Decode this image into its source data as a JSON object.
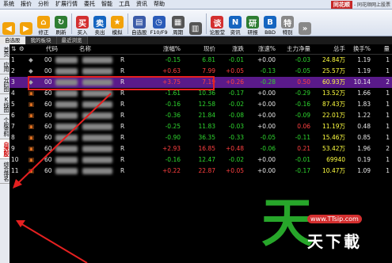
{
  "menubar": {
    "items": [
      "系统",
      "报价",
      "分析",
      "扩展行情",
      "委托",
      "智能",
      "工具",
      "资讯",
      "帮助"
    ],
    "logo": "同花顺",
    "title": "- 同花顺网上股票"
  },
  "toolbar": {
    "buttons": [
      {
        "label": "",
        "icon": "arrow-left-icon",
        "color": "#f2a20a"
      },
      {
        "label": "",
        "icon": "arrow-right-icon",
        "color": "#f2a20a"
      },
      {
        "label": "修正",
        "icon": "home-icon",
        "color": "#f2a20a"
      },
      {
        "label": "刷新",
        "icon": "refresh-icon",
        "color": "#2e7d32"
      },
      {
        "label": "买入",
        "icon": "buy-icon",
        "color": "#d32f2f"
      },
      {
        "label": "卖出",
        "icon": "sell-icon",
        "color": "#1565c0"
      },
      {
        "label": "模拟",
        "icon": "simulate-icon",
        "color": "#f2a20a"
      },
      {
        "label": "自选股",
        "icon": "watchlist-icon",
        "color": "#3b5ba8"
      },
      {
        "label": "F10/F9",
        "icon": "clock-icon",
        "color": "#2a5bb8"
      },
      {
        "label": "周期",
        "icon": "cycle-icon",
        "color": "#555"
      },
      {
        "label": "",
        "icon": "bars-icon",
        "color": "#555"
      },
      {
        "label": "论股堂",
        "icon": "discussion-icon",
        "color": "#d32f2f"
      },
      {
        "label": "资讯",
        "icon": "news-icon",
        "color": "#1565c0"
      },
      {
        "label": "研报",
        "icon": "report-icon",
        "color": "#2e7d32"
      },
      {
        "label": "BBD",
        "icon": "bbd-icon",
        "color": "#1565c0"
      },
      {
        "label": "特别",
        "icon": "special-icon",
        "color": "#888"
      },
      {
        "label": "",
        "icon": "more-icon",
        "color": "#888"
      }
    ]
  },
  "tabs": [
    {
      "label": "自选股",
      "active": true
    },
    {
      "label": "我的板块",
      "active": false
    },
    {
      "label": "最近浏览",
      "active": false
    }
  ],
  "sidepanel": [
    {
      "label": "首页",
      "active": false
    },
    {
      "label": "应用",
      "active": false
    },
    {
      "label": "分时图",
      "active": false
    },
    {
      "label": "K线图",
      "active": false
    },
    {
      "label": "个股资料",
      "active": false
    },
    {
      "label": "自选股",
      "active": true
    },
    {
      "label": "综合排名",
      "active": false
    }
  ],
  "table": {
    "headers": [
      "代码",
      "名称",
      "",
      "涨幅%",
      "现价",
      "涨跌",
      "涨速%",
      "主力净量",
      "总手",
      "换手%",
      "量"
    ],
    "rows": [
      {
        "n": "1",
        "code": "00",
        "name": "",
        "flag": "R",
        "pct": "-0.15",
        "price": "6.81",
        "chg": "-0.01",
        "speed": "+0.00",
        "net": "-0.03",
        "vol": "24.84万",
        "turn": "1.19",
        "qty": "1",
        "dir": "dn"
      },
      {
        "n": "2",
        "code": "00",
        "name": "",
        "flag": "R",
        "pct": "+0.63",
        "price": "7.99",
        "chg": "+0.05",
        "speed": "-0.13",
        "net": "-0.05",
        "vol": "25.57万",
        "turn": "1.19",
        "qty": "1",
        "dir": "up"
      },
      {
        "n": "3",
        "code": "00",
        "name": "",
        "flag": "R",
        "pct": "+3.75",
        "price": "7.19",
        "chg": "+0.26",
        "speed": "-0.28",
        "net": "0.50",
        "vol": "60.93万",
        "turn": "10.14",
        "qty": "2",
        "dir": "up",
        "selected": true
      },
      {
        "n": "4",
        "code": "60",
        "name": "",
        "flag": "R",
        "pct": "-1.61",
        "price": "10.36",
        "chg": "-0.17",
        "speed": "+0.00",
        "net": "-0.29",
        "vol": "13.52万",
        "turn": "1.66",
        "qty": "1",
        "dir": "dn"
      },
      {
        "n": "5",
        "code": "60",
        "name": "",
        "flag": "R",
        "pct": "-0.16",
        "price": "12.58",
        "chg": "-0.02",
        "speed": "+0.00",
        "net": "-0.16",
        "vol": "87.43万",
        "turn": "1.83",
        "qty": "1",
        "dir": "dn"
      },
      {
        "n": "6",
        "code": "60",
        "name": "",
        "flag": "R",
        "pct": "-0.36",
        "price": "21.84",
        "chg": "-0.08",
        "speed": "+0.00",
        "net": "-0.09",
        "vol": "22.01万",
        "turn": "1.22",
        "qty": "1",
        "dir": "dn"
      },
      {
        "n": "7",
        "code": "60",
        "name": "",
        "flag": "R",
        "pct": "-0.25",
        "price": "11.83",
        "chg": "-0.03",
        "speed": "+0.00",
        "net": "0.06",
        "vol": "11.19万",
        "turn": "0.48",
        "qty": "1",
        "dir": "dn"
      },
      {
        "n": "8",
        "code": "60",
        "name": "",
        "flag": "R",
        "pct": "-0.90",
        "price": "36.35",
        "chg": "-0.33",
        "speed": "-0.05",
        "net": "-0.11",
        "vol": "15.46万",
        "turn": "0.85",
        "qty": "1",
        "dir": "dn"
      },
      {
        "n": "9",
        "code": "60",
        "name": "",
        "flag": "R",
        "pct": "+2.93",
        "price": "16.85",
        "chg": "+0.48",
        "speed": "-0.06",
        "net": "0.21",
        "vol": "53.42万",
        "turn": "1.96",
        "qty": "2",
        "dir": "up"
      },
      {
        "n": "10",
        "code": "60",
        "name": "",
        "flag": "R",
        "pct": "-0.16",
        "price": "12.47",
        "chg": "-0.02",
        "speed": "+0.00",
        "net": "-0.01",
        "vol": "69940",
        "turn": "0.19",
        "qty": "1",
        "dir": "dn"
      },
      {
        "n": "11",
        "code": "60",
        "name": "",
        "flag": "R",
        "pct": "+0.22",
        "price": "22.87",
        "chg": "+0.05",
        "speed": "+0.00",
        "net": "-0.17",
        "vol": "10.47万",
        "turn": "1.09",
        "qty": "1",
        "dir": "up"
      }
    ]
  },
  "watermark": {
    "big": "天",
    "url": "www.TTsip.com",
    "text": "天下載"
  }
}
